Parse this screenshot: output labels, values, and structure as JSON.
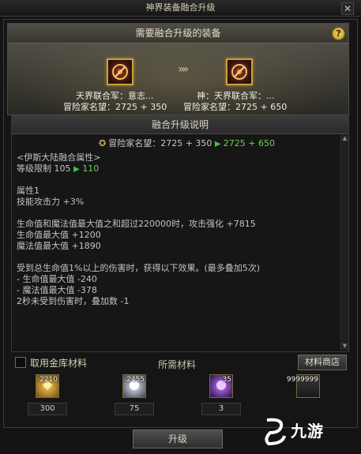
{
  "window": {
    "title": "神界装备融合升级",
    "close_label": "✕"
  },
  "equip": {
    "header": "需要融合升级的装备",
    "help_label": "?",
    "arrow": "»»",
    "source": {
      "name": "天界联合军：意志...",
      "reputation": "冒险家名望：2725 + 350",
      "icon": "item-icon"
    },
    "target": {
      "name": "神：天界联合军：...",
      "reputation": "冒险家名望：2725 + 650",
      "icon": "item-icon"
    }
  },
  "desc": {
    "header": "融合升级说明",
    "rep_label": "冒险家名望：2725 + 350",
    "rep_new": "2725 + 650",
    "lines": {
      "l1": "<伊斯大陆融合属性>",
      "l2a": "等级限制 105",
      "l2b": "110",
      "l3": "属性1",
      "l4": "技能攻击力 +3%",
      "l5": "生命值和魔法值最大值之和超过220000时，攻击强化 +7815",
      "l6": "生命值最大值 +1200",
      "l7": "魔法值最大值 +1890",
      "l8": "受到总生命值1%以上的伤害时，获得以下效果。(最多叠加5次)",
      "l9": "- 生命值最大值 -240",
      "l10": "- 魔法值最大值 -378",
      "l11": "2秒未受到伤害时，叠加数 -1"
    }
  },
  "materials": {
    "checkbox_label": "取用金库材料",
    "title": "所需材料",
    "shop_label": "材料商店",
    "items": [
      {
        "count": "2210",
        "value": "300",
        "icon": "gold-crystal-icon",
        "color": "#e0a52a"
      },
      {
        "count": "2455",
        "value": "75",
        "icon": "white-orb-icon",
        "color": "#c8d4e6"
      },
      {
        "count": "35",
        "value": "3",
        "icon": "purple-orb-icon",
        "color": "#9b4de0"
      },
      {
        "count": "9999999",
        "value": "",
        "icon": "gold-bar-icon",
        "color": "#d0b060"
      }
    ]
  },
  "upgrade_label": "升级",
  "watermark": "九游"
}
